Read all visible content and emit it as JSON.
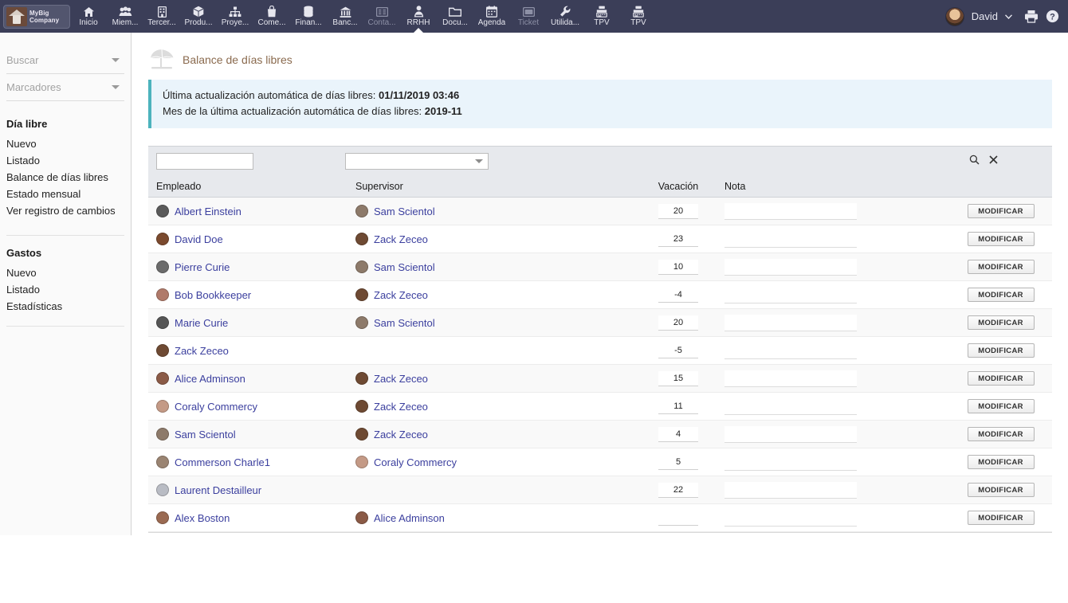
{
  "topnav": {
    "logo": {
      "line1": "MyBig",
      "line2": "Company",
      "icon": "house-logo-icon"
    },
    "items": [
      {
        "label": "Inicio",
        "icon": "home-icon",
        "active": false,
        "dim": false
      },
      {
        "label": "Miem...",
        "icon": "members-icon",
        "active": false,
        "dim": false
      },
      {
        "label": "Tercer...",
        "icon": "building-icon",
        "active": false,
        "dim": false
      },
      {
        "label": "Produ...",
        "icon": "box-icon",
        "active": false,
        "dim": false
      },
      {
        "label": "Proye...",
        "icon": "project-tree-icon",
        "active": false,
        "dim": false
      },
      {
        "label": "Come...",
        "icon": "shopping-bag-icon",
        "active": false,
        "dim": false
      },
      {
        "label": "Finan...",
        "icon": "coins-icon",
        "active": false,
        "dim": false
      },
      {
        "label": "Banc...",
        "icon": "bank-icon",
        "active": false,
        "dim": false
      },
      {
        "label": "Conta...",
        "icon": "accounting-icon",
        "active": false,
        "dim": true
      },
      {
        "label": "RRHH",
        "icon": "user-tie-icon",
        "active": true,
        "dim": false
      },
      {
        "label": "Docu...",
        "icon": "folder-icon",
        "active": false,
        "dim": false
      },
      {
        "label": "Agenda",
        "icon": "calendar-icon",
        "active": false,
        "dim": false
      },
      {
        "label": "Ticket",
        "icon": "ticket-icon",
        "active": false,
        "dim": true
      },
      {
        "label": "Utilida...",
        "icon": "wrench-icon",
        "active": false,
        "dim": false
      },
      {
        "label": "TPV",
        "icon": "cash-register-icon",
        "active": false,
        "dim": false
      },
      {
        "label": "TPV",
        "icon": "cash-register-icon",
        "active": false,
        "dim": false
      }
    ],
    "user_name": "David",
    "user_avatar": "avatar",
    "chevron": "chevron-down-icon",
    "print_icon": "printer-icon",
    "help_icon": "help-circle-icon"
  },
  "sidebar": {
    "search": {
      "label": "Buscar",
      "caret": "chevron-down-icon"
    },
    "bookmarks": {
      "label": "Marcadores",
      "caret": "chevron-down-icon"
    },
    "groups": [
      {
        "title": "Día libre",
        "links": [
          "Nuevo",
          "Listado",
          "Balance de días libres",
          "Estado mensual",
          "Ver registro de cambios"
        ]
      },
      {
        "title": "Gastos",
        "links": [
          "Nuevo",
          "Listado",
          "Estadísticas"
        ]
      }
    ]
  },
  "page": {
    "title": "Balance de días libres",
    "title_icon": "beach-umbrella-icon",
    "banner": {
      "line1_label": "Última actualización automática de días libres:",
      "line1_value": "01/11/2019 03:46",
      "line2_label": "Mes de la última actualización automática de días libres:",
      "line2_value": "2019-11"
    }
  },
  "filters": {
    "employee_value": "",
    "employee_placeholder": "",
    "supervisor_value": "",
    "supervisor_caret": "chevron-down-icon",
    "search_icon": "search-icon",
    "clear_icon": "close-icon"
  },
  "table": {
    "columns": [
      "Empleado",
      "Supervisor",
      "Vacación",
      "Nota",
      ""
    ],
    "action_label": "MODIFICAR",
    "rows": [
      {
        "employee": "Albert Einstein",
        "supervisor": "Sam Scientol",
        "vacation": "20",
        "note": "",
        "emp_av": "#5a5a5a",
        "sup_av": "#8d7a6a"
      },
      {
        "employee": "David Doe",
        "supervisor": "Zack Zeceo",
        "vacation": "23",
        "note": "",
        "emp_av": "#7b4a2e",
        "sup_av": "#6e4a33"
      },
      {
        "employee": "Pierre Curie",
        "supervisor": "Sam Scientol",
        "vacation": "10",
        "note": "",
        "emp_av": "#6b6b6b",
        "sup_av": "#8d7a6a"
      },
      {
        "employee": "Bob Bookkeeper",
        "supervisor": "Zack Zeceo",
        "vacation": "-4",
        "note": "",
        "emp_av": "#b07a6a",
        "sup_av": "#6e4a33"
      },
      {
        "employee": "Marie Curie",
        "supervisor": "Sam Scientol",
        "vacation": "20",
        "note": "",
        "emp_av": "#555555",
        "sup_av": "#8d7a6a"
      },
      {
        "employee": "Zack Zeceo",
        "supervisor": "",
        "vacation": "-5",
        "note": "",
        "emp_av": "#6e4a33",
        "sup_av": ""
      },
      {
        "employee": "Alice Adminson",
        "supervisor": "Zack Zeceo",
        "vacation": "15",
        "note": "",
        "emp_av": "#8a5a46",
        "sup_av": "#6e4a33"
      },
      {
        "employee": "Coraly Commercy",
        "supervisor": "Zack Zeceo",
        "vacation": "11",
        "note": "",
        "emp_av": "#c49a86",
        "sup_av": "#6e4a33"
      },
      {
        "employee": "Sam Scientol",
        "supervisor": "Zack Zeceo",
        "vacation": "4",
        "note": "",
        "emp_av": "#8d7a6a",
        "sup_av": "#6e4a33"
      },
      {
        "employee": "Commerson Charle1",
        "supervisor": "Coraly Commercy",
        "vacation": "5",
        "note": "",
        "emp_av": "#9a8472",
        "sup_av": "#c49a86"
      },
      {
        "employee": "Laurent Destailleur",
        "supervisor": "",
        "vacation": "22",
        "note": "",
        "emp_av": "#b9bcc4",
        "sup_av": ""
      },
      {
        "employee": "Alex Boston",
        "supervisor": "Alice Adminson",
        "vacation": "",
        "note": "",
        "emp_av": "#9a6a52",
        "sup_av": "#8a5a46"
      }
    ]
  },
  "colors": {
    "navbar": "#3b3e58",
    "banner_bg": "#eaf4fb",
    "banner_accent": "#4cb3bd",
    "title": "#8a6a4e",
    "link": "#3b3f9e",
    "table_header_bg": "#e7e9ed"
  }
}
